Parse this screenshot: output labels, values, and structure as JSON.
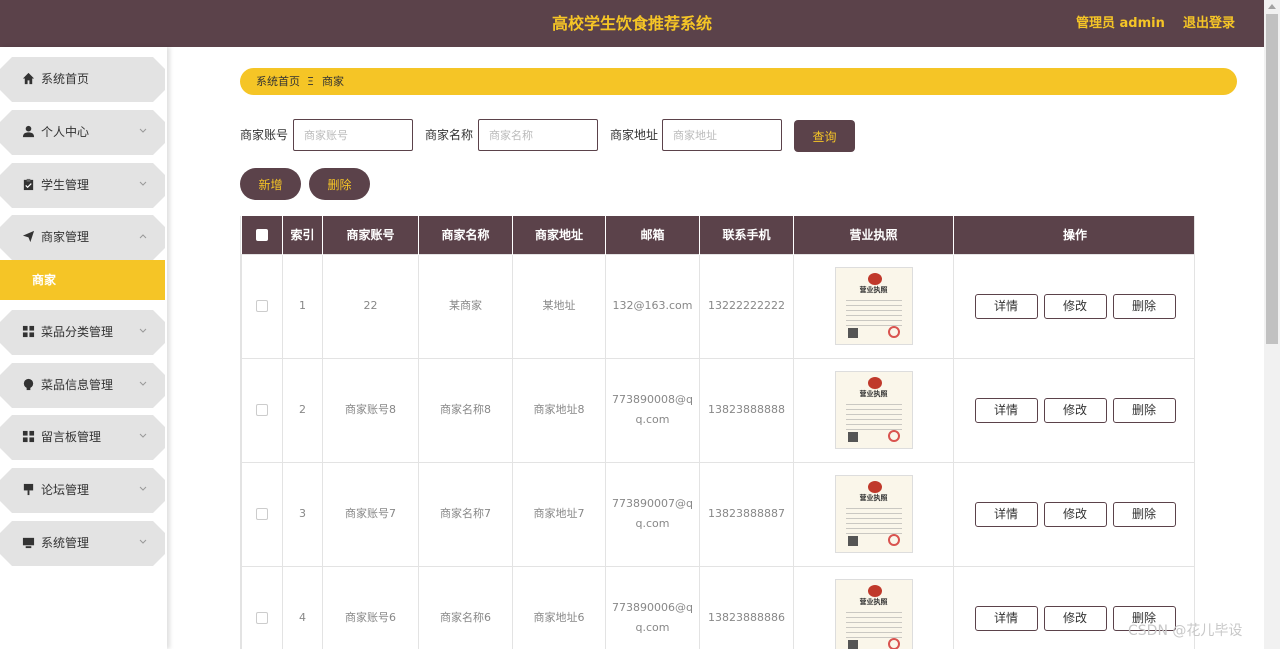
{
  "header": {
    "title": "高校学生饮食推荐系统",
    "user": "管理员 admin",
    "logout": "退出登录"
  },
  "sidebar": {
    "items": [
      {
        "label": "系统首页",
        "icon": "home-icon"
      },
      {
        "label": "个人中心",
        "icon": "user-icon"
      },
      {
        "label": "学生管理",
        "icon": "clipboard-icon"
      },
      {
        "label": "商家管理",
        "icon": "paper-plane-icon"
      },
      {
        "label": "菜品分类管理",
        "icon": "grid-icon"
      },
      {
        "label": "菜品信息管理",
        "icon": "bulb-icon"
      },
      {
        "label": "留言板管理",
        "icon": "grid-icon"
      },
      {
        "label": "论坛管理",
        "icon": "tag-icon"
      },
      {
        "label": "系统管理",
        "icon": "desktop-icon"
      }
    ],
    "active_sub": "商家"
  },
  "breadcrumb": {
    "home": "系统首页",
    "separator": "Ξ",
    "current": "商家"
  },
  "search": {
    "account_label": "商家账号",
    "account_placeholder": "商家账号",
    "name_label": "商家名称",
    "name_placeholder": "商家名称",
    "address_label": "商家地址",
    "address_placeholder": "商家地址",
    "query_button": "查询"
  },
  "actions": {
    "add": "新增",
    "delete": "删除"
  },
  "table": {
    "headers": [
      "索引",
      "商家账号",
      "商家名称",
      "商家地址",
      "邮箱",
      "联系手机",
      "营业执照",
      "操作"
    ],
    "license_title": "营业执照",
    "row_buttons": {
      "detail": "详情",
      "edit": "修改",
      "delete": "删除"
    },
    "rows": [
      {
        "index": "1",
        "account": "22",
        "name": "某商家",
        "address": "某地址",
        "email": "132@163.com",
        "phone": "13222222222"
      },
      {
        "index": "2",
        "account": "商家账号8",
        "name": "商家名称8",
        "address": "商家地址8",
        "email": "773890008@qq.com",
        "phone": "13823888888"
      },
      {
        "index": "3",
        "account": "商家账号7",
        "name": "商家名称7",
        "address": "商家地址7",
        "email": "773890007@qq.com",
        "phone": "13823888887"
      },
      {
        "index": "4",
        "account": "商家账号6",
        "name": "商家名称6",
        "address": "商家地址6",
        "email": "773890006@qq.com",
        "phone": "13823888886"
      }
    ]
  },
  "watermark": "CSDN @花儿毕设",
  "colors": {
    "primary": "#5b424a",
    "accent": "#f5c526"
  }
}
